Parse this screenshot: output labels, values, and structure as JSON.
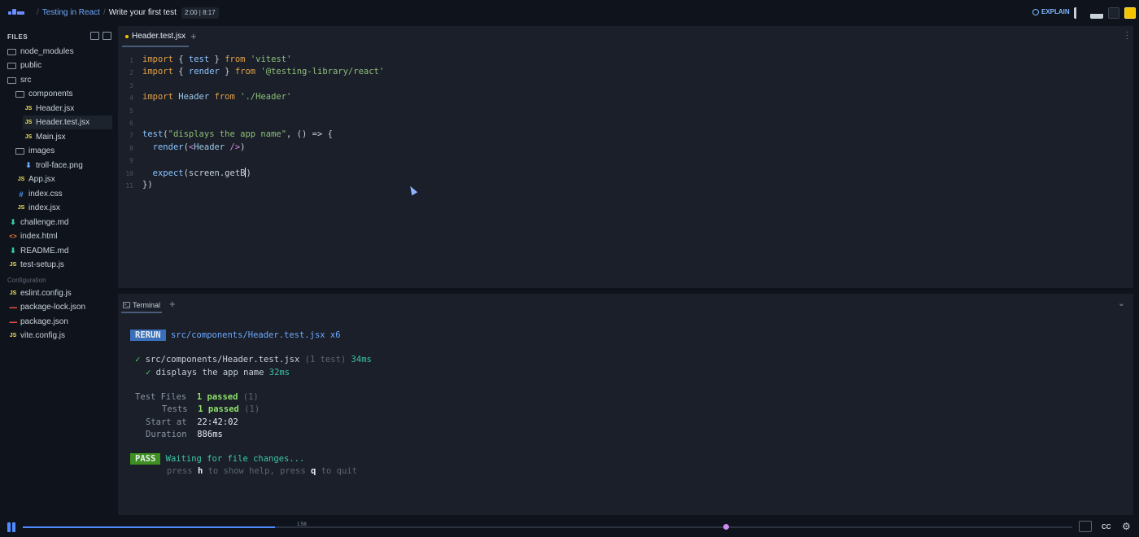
{
  "topbar": {
    "breadcrumb_sep": "/",
    "course": "Testing in React",
    "lesson": "Write your first test",
    "timer": "2:00 | 8:17",
    "explain_label": "EXPLAIN"
  },
  "sidebar": {
    "header": "FILES",
    "items": [
      {
        "label": "node_modules",
        "type": "folder"
      },
      {
        "label": "public",
        "type": "folder"
      },
      {
        "label": "src",
        "type": "folder"
      },
      {
        "label": "components",
        "type": "folder"
      },
      {
        "label": "Header.jsx",
        "type": "js"
      },
      {
        "label": "Header.test.jsx",
        "type": "js"
      },
      {
        "label": "Main.jsx",
        "type": "js"
      },
      {
        "label": "images",
        "type": "folder"
      },
      {
        "label": "troll-face.png",
        "type": "png"
      },
      {
        "label": "App.jsx",
        "type": "js"
      },
      {
        "label": "index.css",
        "type": "css"
      },
      {
        "label": "index.jsx",
        "type": "js"
      },
      {
        "label": "challenge.md",
        "type": "md"
      },
      {
        "label": "index.html",
        "type": "html"
      },
      {
        "label": "README.md",
        "type": "md"
      },
      {
        "label": "test-setup.js",
        "type": "js"
      }
    ],
    "config_section": "Configuration",
    "config_items": [
      {
        "label": "eslint.config.js",
        "type": "js"
      },
      {
        "label": "package-lock.json",
        "type": "json"
      },
      {
        "label": "package.json",
        "type": "json"
      },
      {
        "label": "vite.config.js",
        "type": "js"
      }
    ]
  },
  "editor": {
    "tab_label": "Header.test.jsx",
    "line_numbers": [
      "1",
      "2",
      "3",
      "4",
      "5",
      "6",
      "7",
      "8",
      "9",
      "10",
      "11"
    ]
  },
  "terminal": {
    "tab_label": "Terminal",
    "rerun_badge": "RERUN",
    "rerun_path": "src/components/Header.test.jsx x6",
    "check": "✓",
    "file_result": "src/components/Header.test.jsx",
    "file_count": "(1 test)",
    "file_time": "34ms",
    "test_name": "displays the app name",
    "test_time": "32ms",
    "summary": [
      {
        "label": "Test Files",
        "value": "1 passed",
        "extra": "(1)"
      },
      {
        "label": "Tests",
        "value": "1 passed",
        "extra": "(1)"
      },
      {
        "label": "Start at",
        "value": "22:42:02",
        "extra": ""
      },
      {
        "label": "Duration",
        "value": "886ms",
        "extra": ""
      }
    ],
    "pass_badge": "PASS",
    "waiting": "Waiting for file changes...",
    "help_press": "press",
    "help_h": "h",
    "help_mid": "to show help, press",
    "help_q": "q",
    "help_end": "to quit"
  },
  "player": {
    "hover_time": "1:58",
    "progress": 0.24,
    "marker_position": 0.67,
    "cc_label": "CC"
  },
  "colors": {
    "accent": "#4e8cff",
    "pass": "#3f8f20",
    "rerun": "#3a6fba",
    "marker": "#c98cf0"
  }
}
